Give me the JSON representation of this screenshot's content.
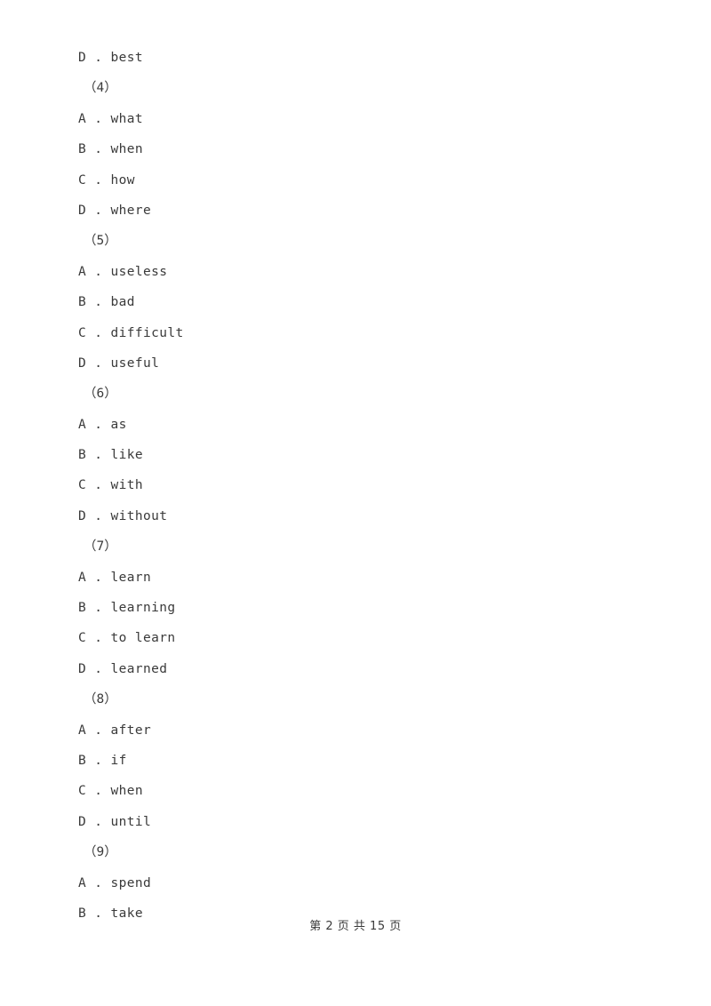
{
  "document": {
    "background_color": "#ffffff",
    "text_color": "#3a3a3a",
    "lines": [
      {
        "kind": "option",
        "text": "D . best"
      },
      {
        "kind": "group",
        "text": "（4）"
      },
      {
        "kind": "option",
        "text": "A . what"
      },
      {
        "kind": "option",
        "text": "B . when"
      },
      {
        "kind": "option",
        "text": "C . how"
      },
      {
        "kind": "option",
        "text": "D . where"
      },
      {
        "kind": "group",
        "text": "（5）"
      },
      {
        "kind": "option",
        "text": "A . useless"
      },
      {
        "kind": "option",
        "text": "B . bad"
      },
      {
        "kind": "option",
        "text": "C . difficult"
      },
      {
        "kind": "option",
        "text": "D . useful"
      },
      {
        "kind": "group",
        "text": "（6）"
      },
      {
        "kind": "option",
        "text": "A . as"
      },
      {
        "kind": "option",
        "text": "B . like"
      },
      {
        "kind": "option",
        "text": "C . with"
      },
      {
        "kind": "option",
        "text": "D . without"
      },
      {
        "kind": "group",
        "text": "（7）"
      },
      {
        "kind": "option",
        "text": "A . learn"
      },
      {
        "kind": "option",
        "text": "B . learning"
      },
      {
        "kind": "option",
        "text": "C . to learn"
      },
      {
        "kind": "option",
        "text": "D . learned"
      },
      {
        "kind": "group",
        "text": "（8）"
      },
      {
        "kind": "option",
        "text": "A . after"
      },
      {
        "kind": "option",
        "text": "B . if"
      },
      {
        "kind": "option",
        "text": "C . when"
      },
      {
        "kind": "option",
        "text": "D . until"
      },
      {
        "kind": "group",
        "text": "（9）"
      },
      {
        "kind": "option",
        "text": "A . spend"
      },
      {
        "kind": "option",
        "text": "B . take"
      }
    ]
  },
  "footer": {
    "text": "第 2 页 共 15 页",
    "current_page": "2",
    "total_pages": "15"
  }
}
